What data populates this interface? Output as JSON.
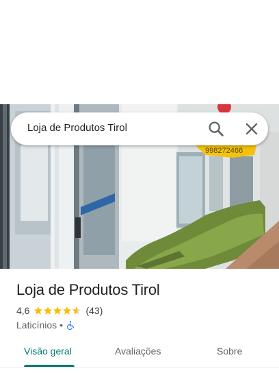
{
  "search": {
    "query": "Loja de Produtos Tirol",
    "search_icon": "search-icon",
    "close_icon": "close-icon"
  },
  "photo": {
    "sign_text": "998272466"
  },
  "place": {
    "name": "Loja de Produtos Tirol",
    "rating": "4,6",
    "stars": 4.6,
    "review_count": "(43)",
    "category": "Laticínios",
    "separator": "•",
    "accessibility_icon": "wheelchair-accessible-icon"
  },
  "tabs": [
    {
      "label": "Visão geral",
      "active": true
    },
    {
      "label": "Avaliações",
      "active": false
    },
    {
      "label": "Sobre",
      "active": false
    }
  ],
  "colors": {
    "accent": "#00796b",
    "star": "#fbbc04",
    "accessibility": "#1a73e8"
  }
}
